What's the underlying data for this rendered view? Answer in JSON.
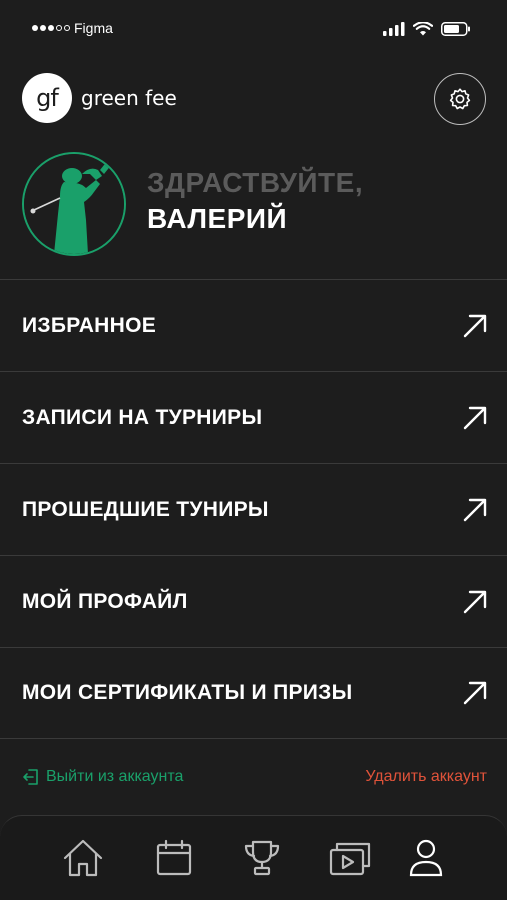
{
  "status_bar": {
    "carrier": "Figma"
  },
  "header": {
    "logo_mark": "gf",
    "logo_text": "green  fee",
    "settings_icon": "settings-icon"
  },
  "greeting": {
    "line1": "ЗДРАСТВУЙТЕ,",
    "line2": "ВАЛЕРИЙ"
  },
  "menu": {
    "items": [
      {
        "label": "ИЗБРАННОЕ"
      },
      {
        "label": "ЗАПИСИ НА ТУРНИРЫ"
      },
      {
        "label": "ПРОШЕДШИЕ ТУНИРЫ"
      },
      {
        "label": "МОЙ ПРОФАЙЛ"
      },
      {
        "label": "МОИ СЕРТИФИКАТЫ И ПРИЗЫ"
      }
    ]
  },
  "account": {
    "logout_label": "Выйти из аккаунта",
    "delete_label": "Удалить аккаунт"
  },
  "tabbar": {
    "tabs": [
      {
        "icon": "home-icon"
      },
      {
        "icon": "calendar-icon"
      },
      {
        "icon": "trophy-icon"
      },
      {
        "icon": "video-icon"
      },
      {
        "icon": "profile-icon",
        "active": true
      }
    ]
  },
  "colors": {
    "background": "#1d1d1d",
    "accent_green": "#1aa06a",
    "danger": "#e0533a",
    "muted": "#5b5b5b"
  }
}
